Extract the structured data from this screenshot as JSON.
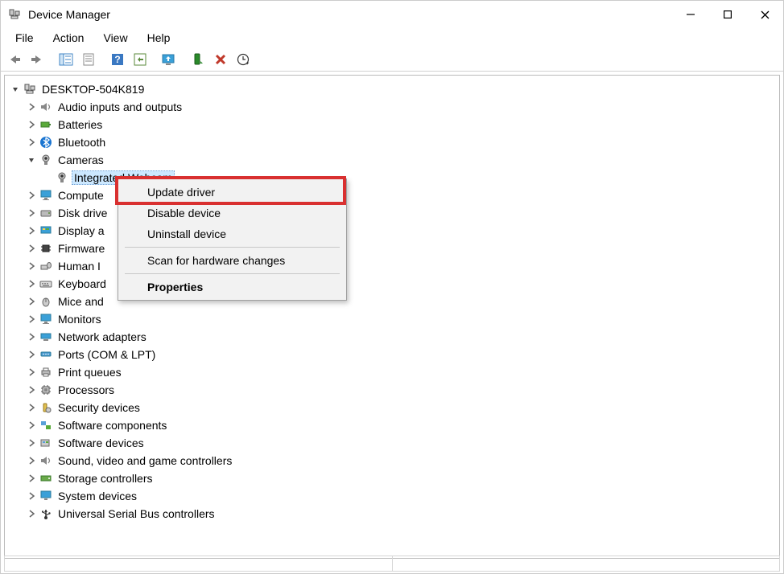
{
  "window": {
    "title": "Device Manager"
  },
  "menu": {
    "file": "File",
    "action": "Action",
    "view": "View",
    "help": "Help"
  },
  "tree": {
    "root": "DESKTOP-504K819",
    "audio": "Audio inputs and outputs",
    "batteries": "Batteries",
    "bluetooth": "Bluetooth",
    "cameras": "Cameras",
    "integrated_webcam": "Integrated Webcam",
    "computer": "Compute",
    "disk": "Disk drive",
    "display": "Display a",
    "firmware": "Firmware",
    "hid": "Human I",
    "keyboards": "Keyboard",
    "mice": "Mice and",
    "monitors": "Monitors",
    "network": "Network adapters",
    "ports": "Ports (COM & LPT)",
    "printq": "Print queues",
    "processors": "Processors",
    "security": "Security devices",
    "swcomp": "Software components",
    "swdev": "Software devices",
    "sound": "Sound, video and game controllers",
    "storage": "Storage controllers",
    "system": "System devices",
    "usb": "Universal Serial Bus controllers"
  },
  "context_menu": {
    "update_driver": "Update driver",
    "disable_device": "Disable device",
    "uninstall_device": "Uninstall device",
    "scan": "Scan for hardware changes",
    "properties": "Properties"
  }
}
